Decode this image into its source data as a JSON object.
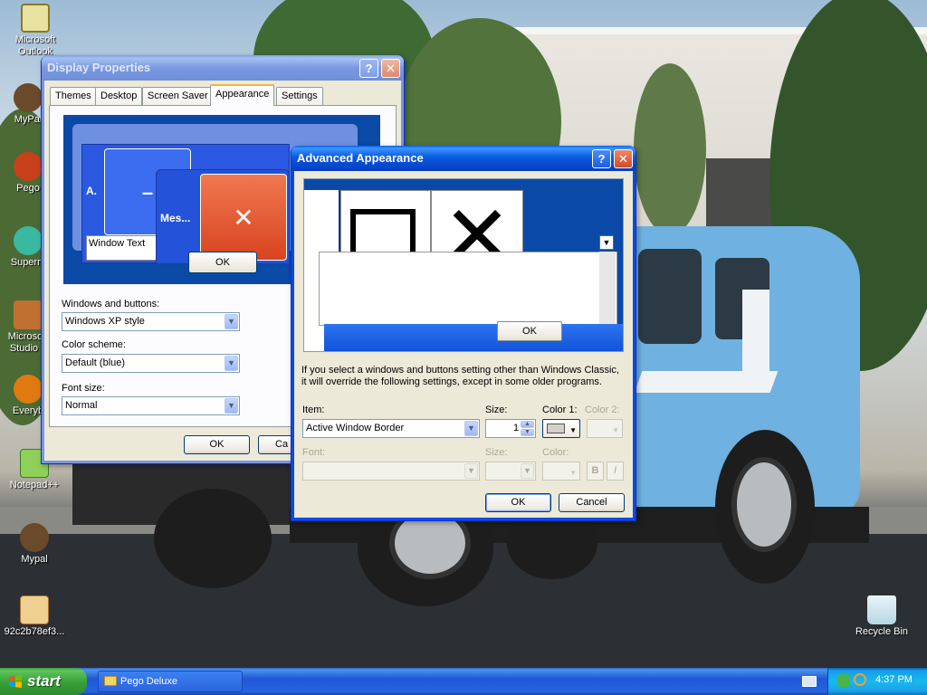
{
  "desktop": {
    "icons": [
      {
        "label": "Microsoft Outlook"
      },
      {
        "label": "MyPal"
      },
      {
        "label": "Pego"
      },
      {
        "label": "Superm"
      },
      {
        "label": "Microsoft Studio 2"
      },
      {
        "label": "Everyb"
      },
      {
        "label": "Notepad++"
      },
      {
        "label": "Mypal"
      },
      {
        "label": "92c2b78ef3..."
      },
      {
        "label": "Recycle Bin"
      }
    ]
  },
  "display_properties": {
    "title": "Display Properties",
    "tabs": [
      "Themes",
      "Desktop",
      "Screen Saver",
      "Appearance",
      "Settings"
    ],
    "selected_tab": "Appearance",
    "preview": {
      "inactive_label": "A.",
      "message_label": "Mes...",
      "window_text": "Window Text",
      "ok": "OK"
    },
    "windows_buttons_label": "Windows and buttons:",
    "windows_buttons_value": "Windows XP style",
    "color_scheme_label": "Color scheme:",
    "color_scheme_value": "Default (blue)",
    "font_size_label": "Font size:",
    "font_size_value": "Normal",
    "ok": "OK",
    "cancel_partial": "Ca"
  },
  "advanced_appearance": {
    "title": "Advanced Appearance",
    "preview_ok": "OK",
    "info_text": "If you select a windows and buttons setting other than Windows Classic, it will override the following settings, except in some older programs.",
    "item_label": "Item:",
    "item_value": "Active Window Border",
    "size_label": "Size:",
    "size_value": "1",
    "color1_label": "Color 1:",
    "color2_label": "Color 2:",
    "font_label": "Font:",
    "font_size_label": "Size:",
    "font_color_label": "Color:",
    "bold": "B",
    "italic": "I",
    "ok": "OK",
    "cancel": "Cancel"
  },
  "taskbar": {
    "start": "start",
    "task": "Pego Deluxe",
    "clock": "4:37 PM"
  },
  "colors": {
    "xp_blue": "#0a5fe8",
    "start_green": "#36a036",
    "dialog_bg": "#ece9d8"
  }
}
